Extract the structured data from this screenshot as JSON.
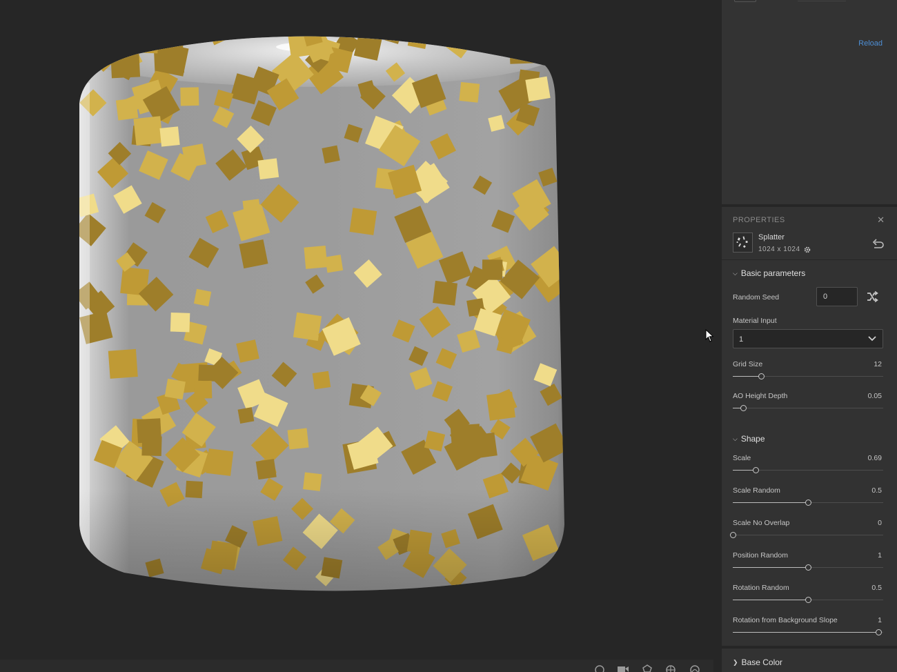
{
  "viewport": {
    "toolbar_icons": [
      "clock-icon",
      "camera-icon",
      "settings-shape-icon",
      "globe-icon",
      "environment-icon"
    ]
  },
  "right_panel": {
    "reload_label": "Reload",
    "properties": {
      "header": "PROPERTIES",
      "close_glyph": "✕",
      "node_name": "Splatter",
      "node_resolution": "1024 x 1024"
    },
    "sections": {
      "basic": {
        "title": "Basic parameters",
        "expanded": true
      },
      "shape": {
        "title": "Shape",
        "expanded": true
      },
      "base_color": {
        "title": "Base Color",
        "expanded": false
      }
    },
    "random_seed": {
      "label": "Random Seed",
      "value": "0"
    },
    "material_input": {
      "label": "Material Input",
      "value": "1"
    },
    "grid_size": {
      "label": "Grid Size",
      "value": "12",
      "fraction": 0.19
    },
    "ao_height_depth": {
      "label": "AO Height Depth",
      "value": "0.05",
      "fraction": 0.07
    },
    "scale": {
      "label": "Scale",
      "value": "0.69",
      "fraction": 0.15
    },
    "scale_random": {
      "label": "Scale Random",
      "value": "0.5",
      "fraction": 0.5
    },
    "scale_no_overlap": {
      "label": "Scale No Overlap",
      "value": "0",
      "fraction": 0.0
    },
    "position_random": {
      "label": "Position Random",
      "value": "1",
      "fraction": 0.5
    },
    "rotation_random": {
      "label": "Rotation Random",
      "value": "0.5",
      "fraction": 0.5
    },
    "rotation_background_slope": {
      "label": "Rotation from Background Slope",
      "value": "1",
      "fraction": 0.97
    }
  },
  "colors": {
    "accent_link": "#4e8fd6",
    "panel_bg": "#323232",
    "viewport_bg": "#262626",
    "gold": "#c9a43a",
    "cylinder_grey": "#9a9a9a"
  }
}
